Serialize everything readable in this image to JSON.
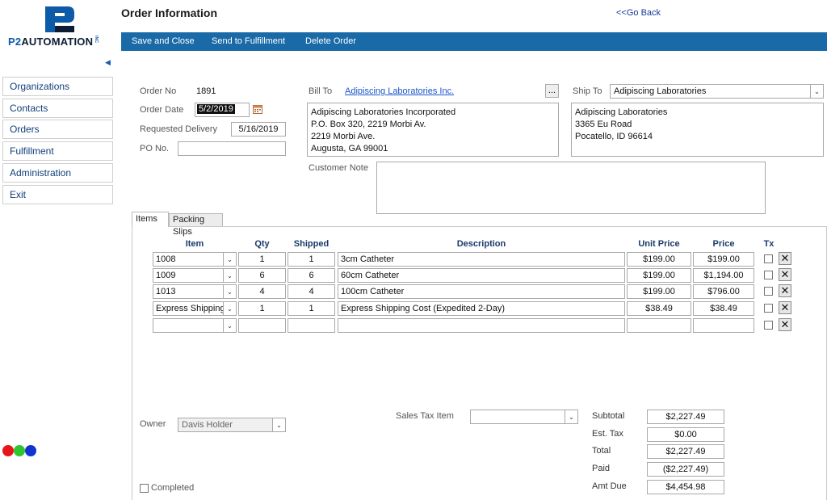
{
  "logo": {
    "text_main": "P2",
    "text_rest": "AUTOMATION",
    "suffix": "INC"
  },
  "header": {
    "title": "Order Information",
    "go_back": "<<Go Back"
  },
  "toolbar": {
    "save_close": "Save and Close",
    "send_fulfillment": "Send to Fulfillment",
    "delete_order": "Delete Order"
  },
  "sidebar": {
    "collapse_glyph": "◀",
    "items": [
      {
        "label": "Organizations"
      },
      {
        "label": "Contacts"
      },
      {
        "label": "Orders"
      },
      {
        "label": "Fulfillment"
      },
      {
        "label": "Administration"
      },
      {
        "label": "Exit"
      }
    ]
  },
  "status_dots": {
    "colors": [
      "#e8141c",
      "#2ec52e",
      "#1233d4"
    ]
  },
  "order": {
    "order_no_label": "Order No",
    "order_no": "1891",
    "order_date_label": "Order Date",
    "order_date": "5/2/2019",
    "requested_delivery_label": "Requested Delivery",
    "requested_delivery": "5/16/2019",
    "po_label": "PO No.",
    "po_value": ""
  },
  "bill_to": {
    "label": "Bill To",
    "link": "Adipiscing Laboratories Inc.",
    "ellipsis": "...",
    "address": [
      "Adipiscing Laboratories Incorporated",
      "P.O. Box 320, 2219 Morbi Av.",
      "2219 Morbi Ave.",
      "Augusta, GA 99001"
    ]
  },
  "ship_to": {
    "label": "Ship To",
    "selected": "Adipiscing Laboratories",
    "address": [
      "Adipiscing Laboratories",
      "3365 Eu Road",
      "Pocatello, ID 96614"
    ]
  },
  "customer_note": {
    "label": "Customer Note",
    "value": ""
  },
  "tabs": [
    {
      "label": "Items"
    },
    {
      "label": "Packing Slips"
    }
  ],
  "items_table": {
    "headers": {
      "item": "Item",
      "qty": "Qty",
      "shipped": "Shipped",
      "description": "Description",
      "unit_price": "Unit Price",
      "price": "Price",
      "tx": "Tx"
    },
    "rows": [
      {
        "item": "1008",
        "qty": "1",
        "shipped": "1",
        "description": "3cm Catheter",
        "unit_price": "$199.00",
        "price": "$199.00"
      },
      {
        "item": "1009",
        "qty": "6",
        "shipped": "6",
        "description": "60cm Catheter",
        "unit_price": "$199.00",
        "price": "$1,194.00"
      },
      {
        "item": "1013",
        "qty": "4",
        "shipped": "4",
        "description": "100cm Catheter",
        "unit_price": "$199.00",
        "price": "$796.00"
      },
      {
        "item": "Express Shipping C",
        "qty": "1",
        "shipped": "1",
        "description": "Express Shipping Cost (Expedited 2-Day)",
        "unit_price": "$38.49",
        "price": "$38.49"
      },
      {
        "item": "",
        "qty": "",
        "shipped": "",
        "description": "",
        "unit_price": "",
        "price": ""
      }
    ],
    "delete_glyph": "✕"
  },
  "owner": {
    "label": "Owner",
    "value": "Davis Holder"
  },
  "sales_tax": {
    "label": "Sales Tax Item",
    "value": ""
  },
  "completed": {
    "label": "Completed"
  },
  "totals": {
    "subtotal_label": "Subtotal",
    "subtotal": "$2,227.49",
    "est_tax_label": "Est. Tax",
    "est_tax": "$0.00",
    "total_label": "Total",
    "total": "$2,227.49",
    "paid_label": "Paid",
    "paid": "($2,227.49)",
    "amt_due_label": "Amt Due",
    "amt_due": "$4,454.98"
  }
}
